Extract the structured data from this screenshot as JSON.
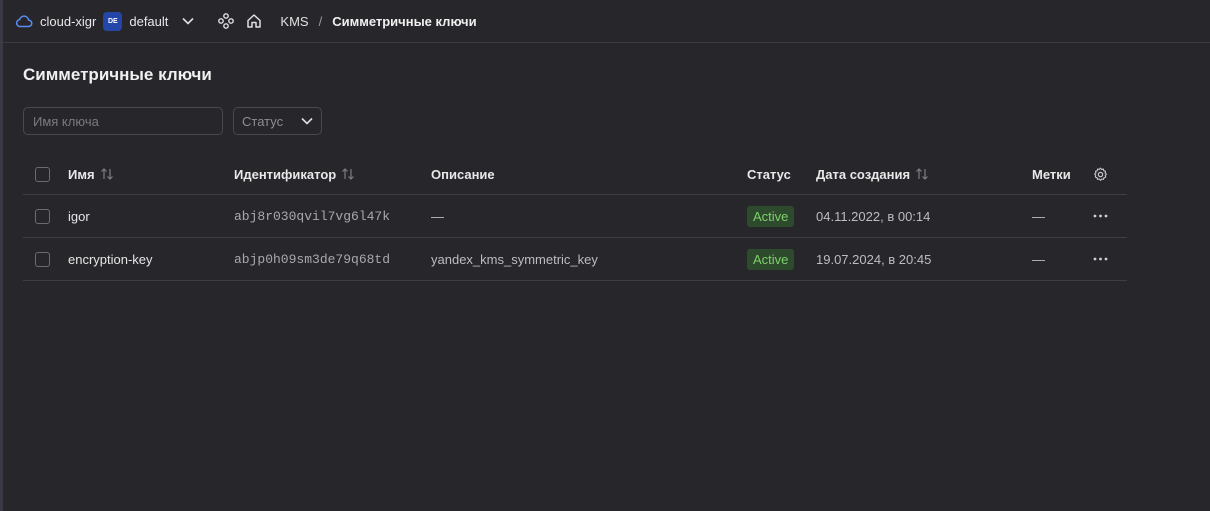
{
  "header": {
    "cloud_name": "cloud-xigr",
    "folder_badge": "DE",
    "folder_name": "default",
    "breadcrumb_service": "KMS",
    "breadcrumb_separator": "/",
    "breadcrumb_current": "Симметричные ключи"
  },
  "page": {
    "title": "Симметричные ключи"
  },
  "filters": {
    "search_placeholder": "Имя ключа",
    "status_label": "Статус"
  },
  "table": {
    "columns": {
      "name": "Имя",
      "id": "Идентификатор",
      "description": "Описание",
      "status": "Статус",
      "created": "Дата создания",
      "labels": "Метки"
    },
    "rows": [
      {
        "name": "igor",
        "id": "abj8r030qvil7vg6l47k",
        "description": "—",
        "status": "Active",
        "created": "04.11.2022, в 00:14",
        "labels": "—"
      },
      {
        "name": "encryption-key",
        "id": "abjp0h09sm3de79q68td",
        "description": "yandex_kms_symmetric_key",
        "status": "Active",
        "created": "19.07.2024, в 20:45",
        "labels": "—"
      }
    ]
  },
  "colors": {
    "background": "#27262b",
    "active_badge_bg": "#2e4a2d",
    "active_badge_text": "#7fcf6d",
    "folder_badge_bg": "#2446a8"
  }
}
